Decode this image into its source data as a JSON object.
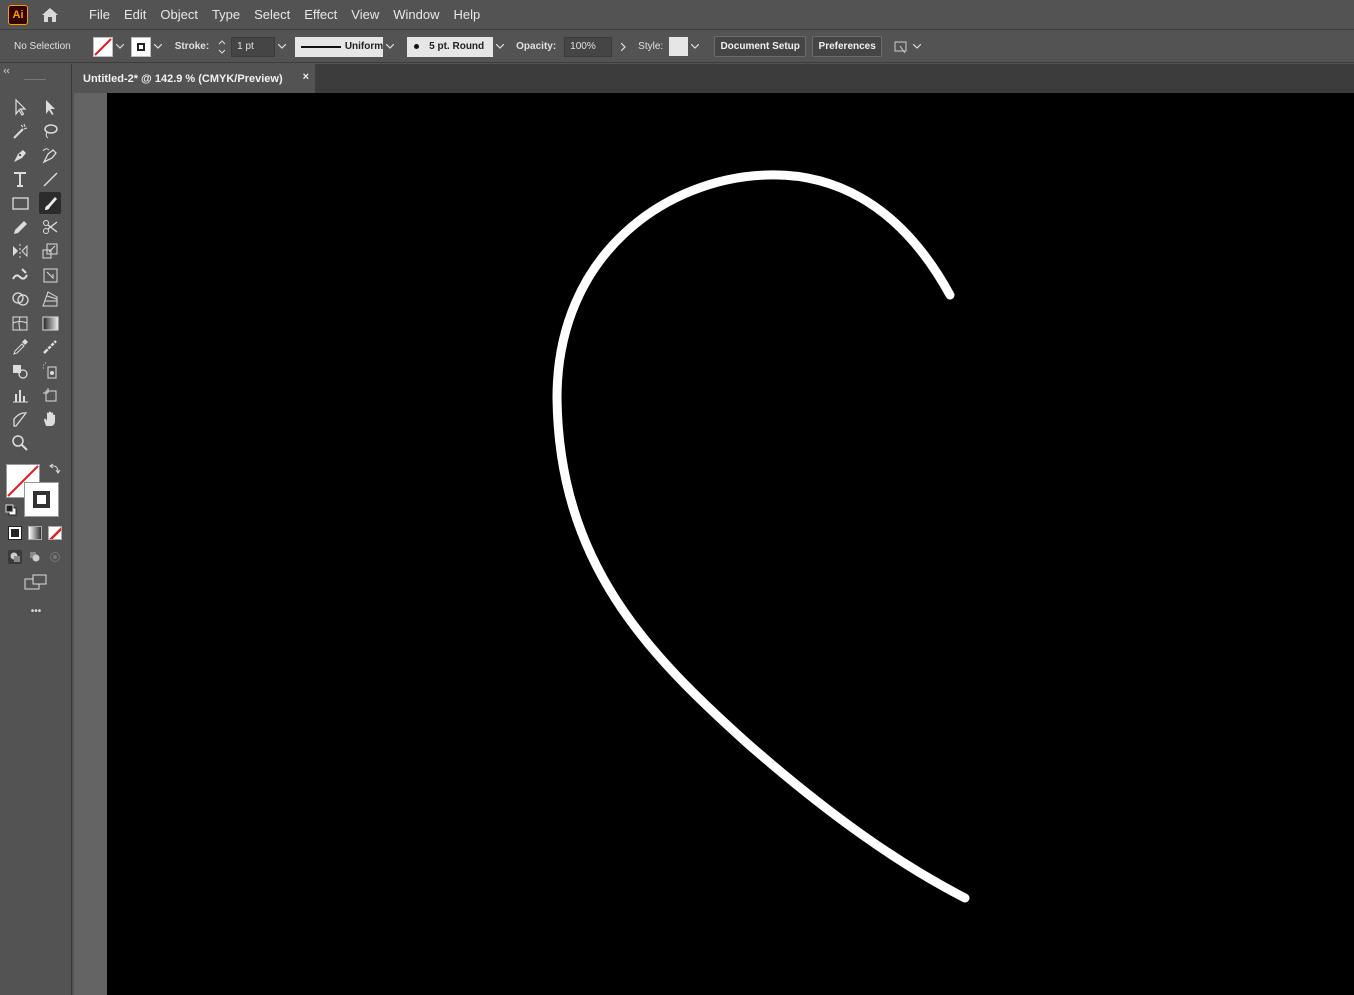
{
  "app": {
    "logo_text": "Ai"
  },
  "menu": {
    "items": [
      "File",
      "Edit",
      "Object",
      "Type",
      "Select",
      "Effect",
      "View",
      "Window",
      "Help"
    ]
  },
  "control_bar": {
    "selection_label": "No Selection",
    "stroke_label": "Stroke:",
    "stroke_value": "1 pt",
    "profile_label": "Uniform",
    "brush_label": "5 pt. Round",
    "opacity_label": "Opacity:",
    "opacity_value": "100%",
    "style_label": "Style:",
    "document_setup_label": "Document Setup",
    "preferences_label": "Preferences"
  },
  "document": {
    "tab_title": "Untitled-2* @ 142.9 % (CMYK/Preview)",
    "close_glyph": "×"
  },
  "toolbar": {
    "more_glyph": "•••",
    "tools": [
      "selection-tool",
      "direct-selection-tool",
      "magic-wand-tool",
      "lasso-tool",
      "pen-tool",
      "curvature-tool",
      "type-tool",
      "line-segment-tool",
      "rectangle-tool",
      "paintbrush-tool",
      "pencil-tool",
      "scissors-tool",
      "reflect-tool",
      "scale-tool",
      "warp-tool",
      "free-transform-tool",
      "shape-builder-tool",
      "perspective-grid-tool",
      "mesh-tool",
      "gradient-tool",
      "eyedropper-tool",
      "measure-tool",
      "blend-tool",
      "symbol-sprayer-tool",
      "column-graph-tool",
      "artboard-tool",
      "slice-tool",
      "hand-tool",
      "zoom-tool"
    ],
    "active_tool": "paintbrush-tool"
  },
  "colors": {
    "ui_bg": "#535353",
    "artboard": "#000000",
    "stroke_path": "#ffffff",
    "none_red": "#e02020"
  }
}
